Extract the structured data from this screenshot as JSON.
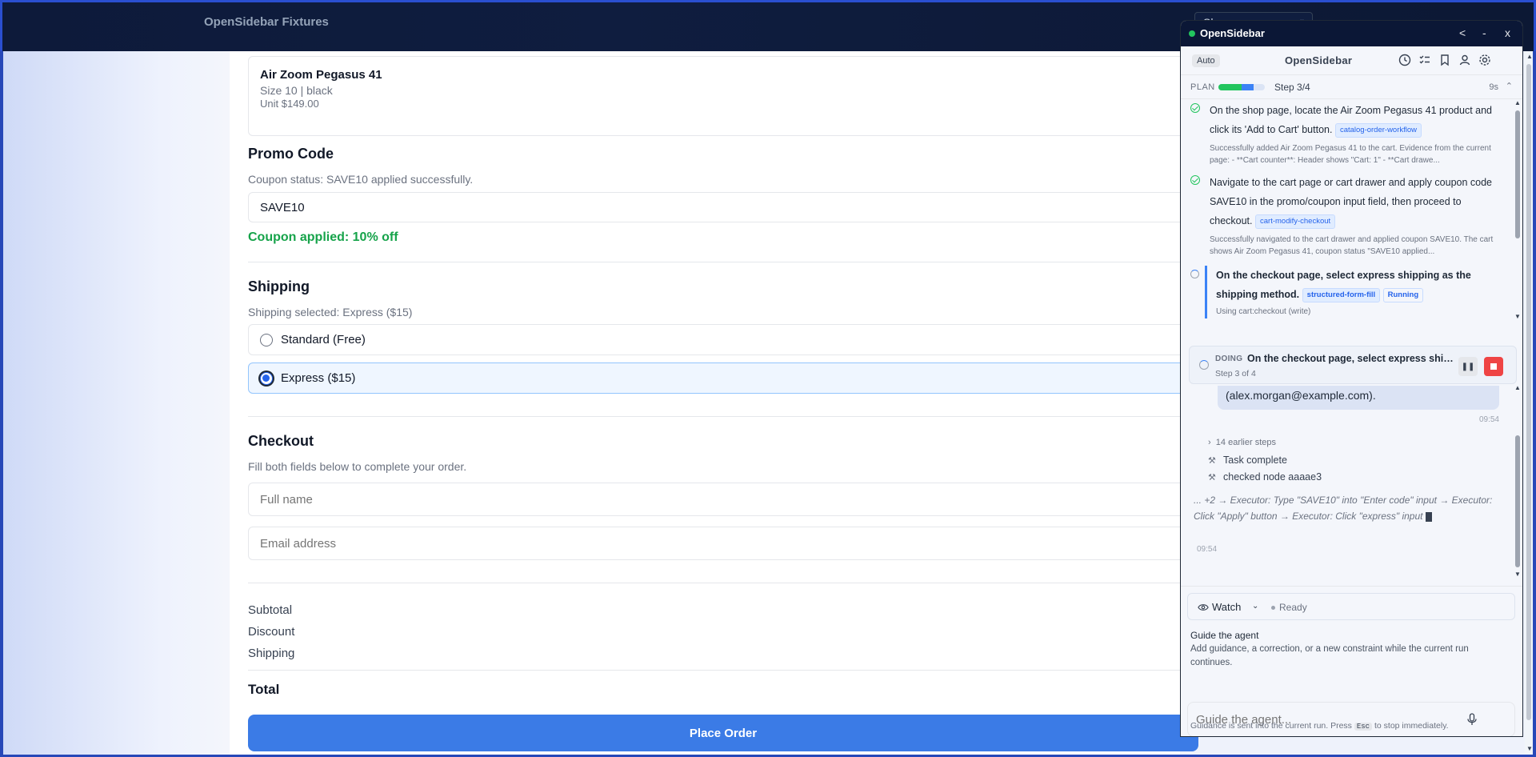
{
  "app": {
    "brand": "OpenSidebar Fixtures",
    "shop_select": "Shop"
  },
  "product": {
    "name": "Air Zoom Pegasus 41",
    "meta": "Size 10 | black",
    "unit": "Unit $149.00"
  },
  "promo": {
    "title": "Promo Code",
    "status": "Coupon status: SAVE10 applied successfully.",
    "value": "SAVE10",
    "applied": "Coupon applied: 10% off"
  },
  "shipping": {
    "title": "Shipping",
    "status": "Shipping selected: Express ($15)",
    "options": [
      {
        "label": "Standard (Free)",
        "selected": false
      },
      {
        "label": "Express ($15)",
        "selected": true
      }
    ]
  },
  "checkout": {
    "title": "Checkout",
    "sub": "Fill both fields below to complete your order.",
    "name_placeholder": "Full name",
    "email_placeholder": "Email address"
  },
  "summary": {
    "subtotal": "Subtotal",
    "discount": "Discount",
    "shipping": "Shipping",
    "total": "Total",
    "place_order": "Place Order"
  },
  "sidebar": {
    "title": "OpenSidebar",
    "controls": {
      "back": "<",
      "minimize": "-",
      "close": "x"
    },
    "mode_badge": "Auto",
    "name": "OpenSidebar",
    "toolbar_icons": [
      "history-icon",
      "checklist-icon",
      "bookmark-icon",
      "user-icon",
      "gear-icon"
    ],
    "plan": {
      "label": "PLAN",
      "step": "Step 3/4",
      "time": "9s",
      "progress_done": 0.5,
      "progress_active": 0.25
    },
    "steps": [
      {
        "status": "done",
        "text": "On the shop page, locate the Air Zoom Pegasus 41 product and click its 'Add to Cart' button.",
        "tag": "catalog-order-workflow",
        "detail": "Successfully added Air Zoom Pegasus 41 to the cart. Evidence from the current page: - **Cart counter**: Header shows \"Cart: 1\" - **Cart drawe..."
      },
      {
        "status": "done",
        "text": "Navigate to the cart page or cart drawer and apply coupon code SAVE10 in the promo/coupon input field, then proceed to checkout.",
        "tag": "cart-modify-checkout",
        "detail": "Successfully navigated to the cart drawer and applied coupon SAVE10. The cart shows Air Zoom Pegasus 41, coupon status \"SAVE10 applied..."
      },
      {
        "status": "running",
        "text": "On the checkout page, select express shipping as the shipping method.",
        "tag": "structured-form-fill",
        "tag2": "Running",
        "detail": "Using cart:checkout (write)"
      }
    ],
    "doing": {
      "label": "DOING",
      "text": "On the checkout page, select express shipping as the shipping method.",
      "sub": "Step 3 of 4"
    },
    "chat": {
      "bubble_tail": "(alex.morgan@example.com).",
      "ts1": "09:54",
      "earlier": "14 earlier steps",
      "log": [
        "Task complete",
        "checked node aaaae3"
      ],
      "exec": "... +2 → Executor: Type \"SAVE10\" into \"Enter code\" input → Executor: Click \"Apply\" button → Executor: Click \"express\" input",
      "ts2": "09:54"
    },
    "composer": {
      "watch": "Watch",
      "ready": "Ready",
      "guide_title": "Guide the agent",
      "guide_desc": "Add guidance, a correction, or a new constraint while the current run continues.",
      "placeholder": "Guide the agent...",
      "foot_pre": "Guidance is sent into the current run. Press",
      "foot_key": "Esc",
      "foot_post": "to stop immediately."
    }
  },
  "colors": {
    "accent": "#3b7be6",
    "success": "#16a34a",
    "stop": "#ef4444",
    "header": "#0b1736"
  }
}
